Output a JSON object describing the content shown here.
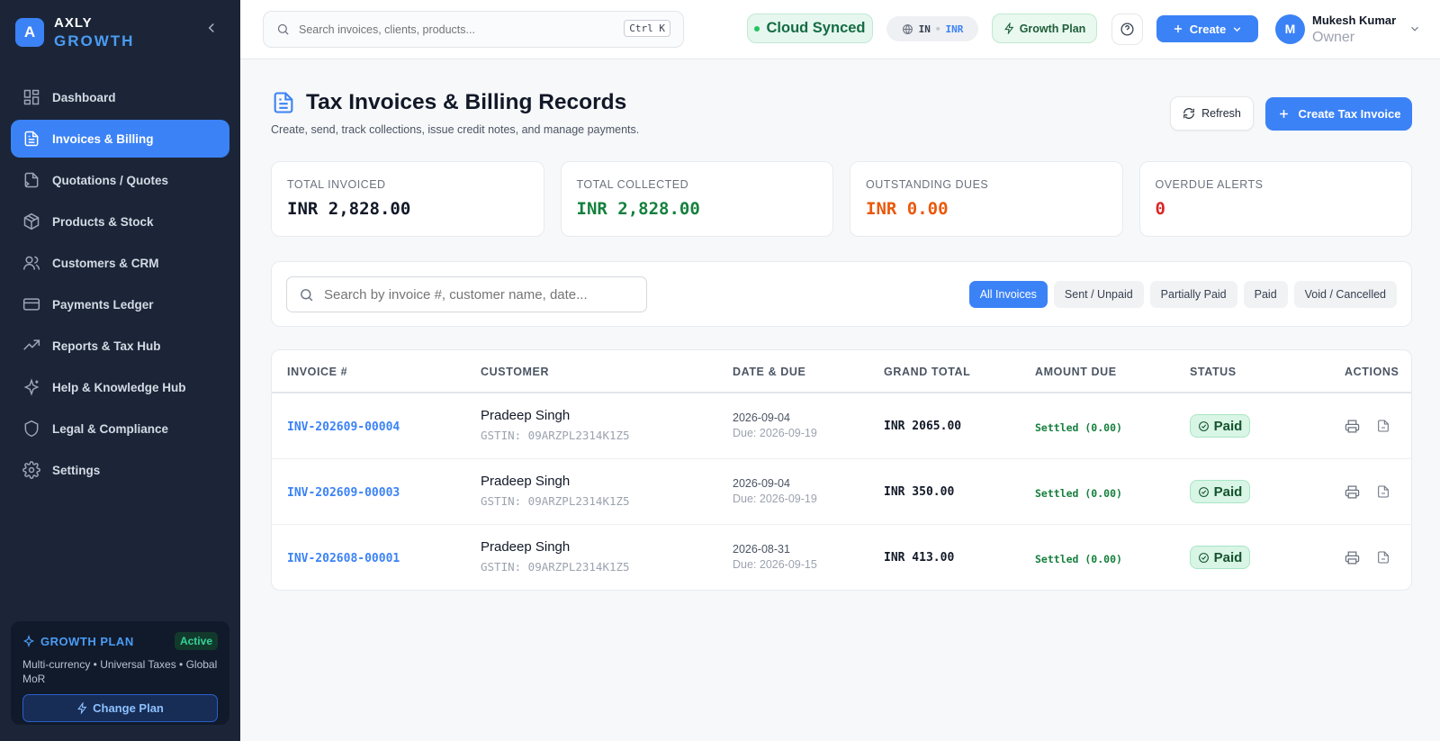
{
  "app": {
    "brand_initial": "A",
    "brand_name": "AXLY",
    "brand_sub": "GROWTH"
  },
  "sidebar": {
    "items": [
      {
        "label": "Dashboard",
        "icon": "dashboard-icon"
      },
      {
        "label": "Invoices & Billing",
        "icon": "document-icon",
        "active": true
      },
      {
        "label": "Quotations / Quotes",
        "icon": "quote-file-icon"
      },
      {
        "label": "Products & Stock",
        "icon": "package-icon"
      },
      {
        "label": "Customers & CRM",
        "icon": "users-icon"
      },
      {
        "label": "Payments Ledger",
        "icon": "credit-card-icon"
      },
      {
        "label": "Reports & Tax Hub",
        "icon": "trending-up-icon"
      },
      {
        "label": "Help & Knowledge Hub",
        "icon": "sparkle-icon"
      },
      {
        "label": "Legal & Compliance",
        "icon": "shield-icon"
      },
      {
        "label": "Settings",
        "icon": "gear-icon"
      }
    ],
    "plan": {
      "title": "GROWTH PLAN",
      "badge": "Active",
      "description": "Multi-currency • Universal Taxes • Global MoR",
      "button": "Change Plan"
    }
  },
  "topbar": {
    "search_placeholder": "Search invoices, clients, products...",
    "shortcut": "Ctrl K",
    "sync_status": "Cloud Synced",
    "locale_country": "IN",
    "locale_separator": "•",
    "locale_currency": "INR",
    "plan_label": "Growth Plan",
    "create_label": "Create",
    "user": {
      "initial": "M",
      "name": "Mukesh Kumar",
      "role": "Owner"
    }
  },
  "page": {
    "title": "Tax Invoices & Billing Records",
    "subtitle": "Create, send, track collections, issue credit notes, and manage payments.",
    "refresh_label": "Refresh",
    "create_invoice_label": "Create Tax Invoice"
  },
  "stats": [
    {
      "label": "TOTAL INVOICED",
      "value": "INR 2,828.00",
      "color": "#111827"
    },
    {
      "label": "TOTAL COLLECTED",
      "value": "INR 2,828.00",
      "color": "#15803d"
    },
    {
      "label": "OUTSTANDING DUES",
      "value": "INR 0.00",
      "color": "#ea580c"
    },
    {
      "label": "OVERDUE ALERTS",
      "value": "0",
      "color": "#dc2626"
    }
  ],
  "filters": {
    "search_placeholder": "Search by invoice #, customer name, date...",
    "chips": [
      "All Invoices",
      "Sent / Unpaid",
      "Partially Paid",
      "Paid",
      "Void / Cancelled"
    ],
    "active": "All Invoices"
  },
  "table": {
    "headers": {
      "invoice": "INVOICE #",
      "customer": "CUSTOMER",
      "date": "DATE & DUE",
      "grand_total": "GRAND TOTAL",
      "amount_due": "AMOUNT DUE",
      "status": "STATUS",
      "actions": "ACTIONS"
    },
    "rows": [
      {
        "invoice": "INV-202609-00004",
        "customer": "Pradeep Singh",
        "gstin": "GSTIN: 09ARZPL2314K1Z5",
        "date": "2026-09-04",
        "due": "Due: 2026-09-19",
        "grand_total": "INR 2065.00",
        "amount_due": "Settled (0.00)",
        "status": "Paid"
      },
      {
        "invoice": "INV-202609-00003",
        "customer": "Pradeep Singh",
        "gstin": "GSTIN: 09ARZPL2314K1Z5",
        "date": "2026-09-04",
        "due": "Due: 2026-09-19",
        "grand_total": "INR 350.00",
        "amount_due": "Settled (0.00)",
        "status": "Paid"
      },
      {
        "invoice": "INV-202608-00001",
        "customer": "Pradeep Singh",
        "gstin": "GSTIN: 09ARZPL2314K1Z5",
        "date": "2026-08-31",
        "due": "Due: 2026-09-15",
        "grand_total": "INR 413.00",
        "amount_due": "Settled (0.00)",
        "status": "Paid"
      }
    ]
  },
  "colors": {
    "accent": "#3b82f6",
    "sidebar_bg": "#1b2537",
    "success": "#15803d"
  }
}
